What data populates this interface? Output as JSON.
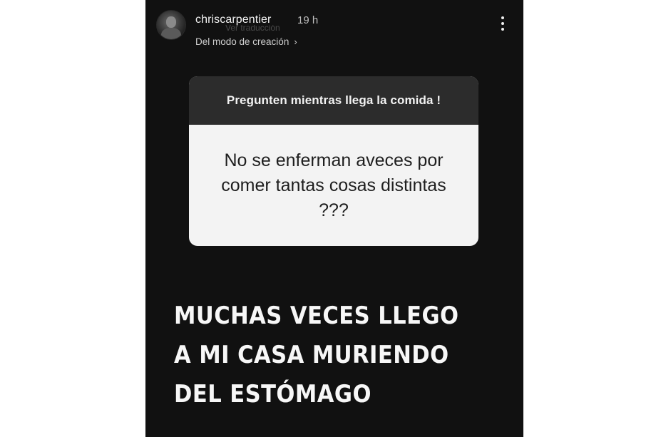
{
  "header": {
    "username": "chriscarpentier",
    "time": "19 h",
    "ghost_text": "Ver traducción",
    "subtitle": "Del modo de creación",
    "subtitle_chevron": "›"
  },
  "question_sticker": {
    "prompt": "Pregunten mientras llega la comida !",
    "question": "No se enferman aveces por comer tantas cosas distintas ???"
  },
  "caption": {
    "lines": [
      "MUCHAS VECES LLEGO",
      "A MI CASA MURIENDO",
      "DEL ESTÓMAGO"
    ]
  },
  "icons": {
    "more_options": "more-vertical-icon",
    "chevron": "chevron-right-icon"
  },
  "colors": {
    "story_background": "#111111",
    "sticker_header": "#2c2c2c",
    "sticker_body": "#f3f3f3",
    "text_light": "#f2f2f2",
    "text_dark": "#1e1e1e"
  }
}
